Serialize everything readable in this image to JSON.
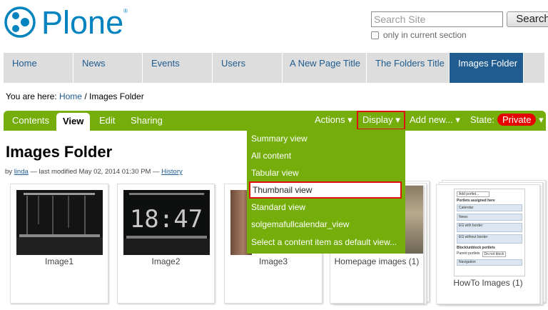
{
  "logo": {
    "text": "Plone",
    "reg": "®"
  },
  "search": {
    "placeholder": "Search Site",
    "button": "Search",
    "only_in_section": "only in current section"
  },
  "global_nav": [
    {
      "label": "Home"
    },
    {
      "label": "News"
    },
    {
      "label": "Events"
    },
    {
      "label": "Users"
    },
    {
      "label": "A New Page Title"
    },
    {
      "label": "The Folders Title"
    },
    {
      "label": "Images Folder",
      "active": true
    }
  ],
  "breadcrumb": {
    "prefix": "You are here:",
    "home": "Home",
    "sep": "/",
    "current": "Images Folder"
  },
  "editbar": {
    "tabs": {
      "contents": "Contents",
      "view": "View",
      "edit": "Edit",
      "sharing": "Sharing"
    },
    "actions": "Actions ▾",
    "display": "Display ▾",
    "add_new": "Add new... ▾",
    "state_label": "State:",
    "state_value": "Private",
    "state_arrow": "▾"
  },
  "display_menu": {
    "items": [
      "Summary view",
      "All content",
      "Tabular view",
      "Thumbnail view",
      "Standard view",
      "solgemafullcalendar_view",
      "Select a content item as default view..."
    ],
    "selected": "Thumbnail view"
  },
  "page": {
    "title": "Images Folder",
    "by": "by",
    "author": "linda",
    "modified": "— last modified May 02, 2014 01:30 PM —",
    "history": "History"
  },
  "thumbnails": [
    {
      "label": "Image1"
    },
    {
      "label": "Image2",
      "clock": "18:47"
    },
    {
      "label": "Image3"
    },
    {
      "label": "Homepage images (1)"
    },
    {
      "label": "HowTo Images (1)"
    }
  ],
  "portlet_preview": {
    "add": "Add portlet...",
    "heading": "Portlets assigned here",
    "rows": [
      "Calendar",
      "News",
      "EG with border",
      "EG without border"
    ],
    "block_heading": "Block/unblock portlets",
    "parent": "Parent portlets",
    "parent_value": "Do not block",
    "nav": "Navigation"
  },
  "colors": {
    "plone_blue": "#0083be",
    "nav_active": "#205c90",
    "editbar_green": "#75ad0a",
    "private_red": "#e60000",
    "highlight_red": "#dd1111"
  }
}
